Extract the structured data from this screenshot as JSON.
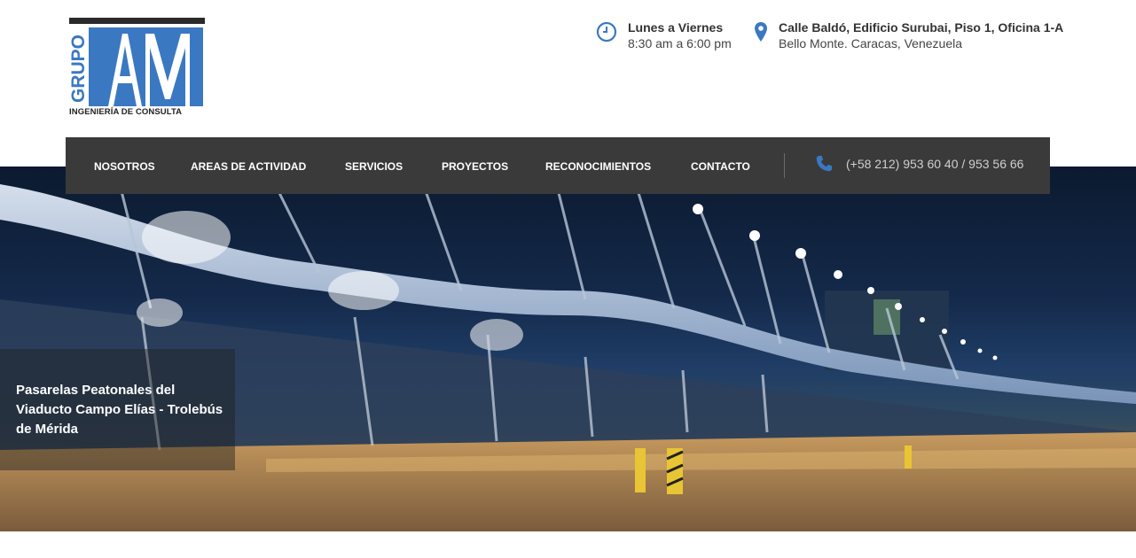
{
  "logo": {
    "vertical_text": "GRUPO",
    "letters": "AM",
    "subtitle": "INGENIERÍA DE CONSULTA",
    "brand_color": "#3b78c2"
  },
  "header": {
    "hours": {
      "title": "Lunes a Viernes",
      "text": "8:30 am a 6:00 pm",
      "icon": "clock-icon"
    },
    "address": {
      "title": "Calle Baldó, Edificio Surubai, Piso 1, Oficina 1-A",
      "text": "Bello Monte. Caracas, Venezuela",
      "icon": "map-pin-icon"
    }
  },
  "nav": {
    "items": [
      {
        "label": "NOSOTROS"
      },
      {
        "label": "AREAS DE ACTIVIDAD"
      },
      {
        "label": "SERVICIOS"
      },
      {
        "label": "PROYECTOS"
      },
      {
        "label": "RECONOCIMIENTOS"
      },
      {
        "label": "CONTACTO"
      }
    ],
    "phone": {
      "text": "(+58 212) 953 60 40 / 953 56 66",
      "icon": "phone-icon"
    },
    "background": "#3a3a3a"
  },
  "hero": {
    "caption": "Pasarelas Peatonales del Viaducto Campo Elías - Trolebús de Mérida"
  },
  "colors": {
    "accent": "#3b78c2",
    "text_dark": "#333333"
  }
}
